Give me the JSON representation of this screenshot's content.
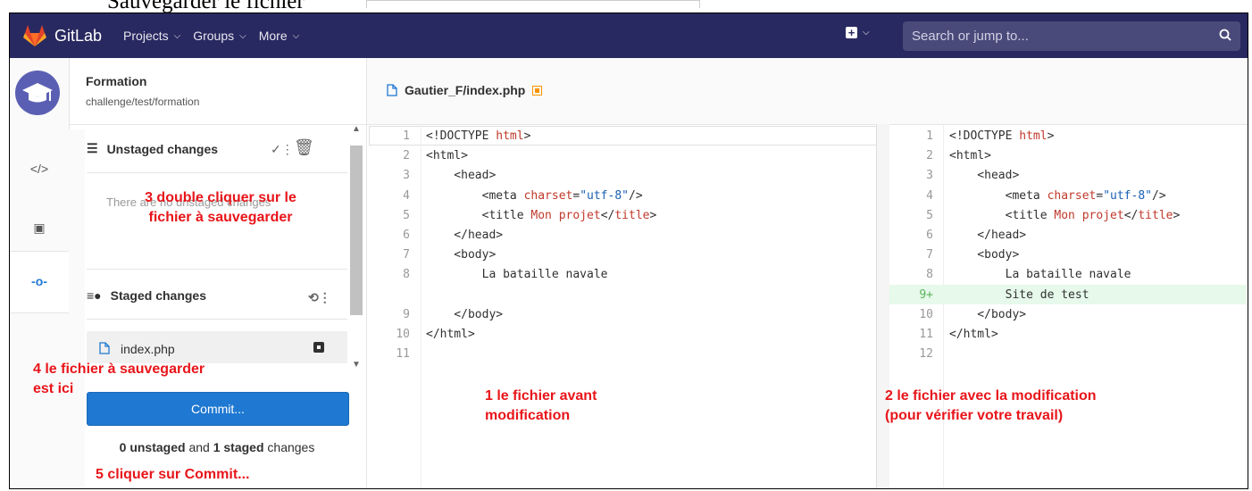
{
  "caption": "Sauvegarder le fichier",
  "navbar": {
    "brand": "GitLab",
    "links": [
      "Projects",
      "Groups",
      "More"
    ],
    "search_placeholder": "Search or jump to...",
    "colors": {
      "bg": "#292961",
      "search_bg": "#4a4a7a"
    }
  },
  "project": {
    "name": "Formation",
    "path": "challenge/test/formation"
  },
  "panel": {
    "unstaged_title": "Unstaged changes",
    "unstaged_empty": "There are no unstaged changes",
    "staged_title": "Staged changes",
    "staged_files": [
      "index.php"
    ],
    "commit_label": "Commit...",
    "summary": {
      "unstaged_count": "0 unstaged",
      "and": " and ",
      "staged_count": "1 staged",
      "suffix": " changes"
    }
  },
  "editor": {
    "file_path": "Gautier_F/index.php",
    "left_lines": [
      {
        "n": "1",
        "code": "<!DOCTYPE html>"
      },
      {
        "n": "2",
        "code": "<html>"
      },
      {
        "n": "3",
        "code": "    <head>"
      },
      {
        "n": "4",
        "code": "        <meta charset=\"utf-8\"/>"
      },
      {
        "n": "5",
        "code": "        <title Mon projet</title>"
      },
      {
        "n": "6",
        "code": "    </head>"
      },
      {
        "n": "7",
        "code": "    <body>"
      },
      {
        "n": "8",
        "code": "        La bataille navale"
      },
      {
        "n": "",
        "code": ""
      },
      {
        "n": "9",
        "code": "    </body>"
      },
      {
        "n": "10",
        "code": "</html>"
      },
      {
        "n": "11",
        "code": ""
      }
    ],
    "right_lines": [
      {
        "n": "1",
        "code": "<!DOCTYPE html>"
      },
      {
        "n": "2",
        "code": "<html>"
      },
      {
        "n": "3",
        "code": "    <head>"
      },
      {
        "n": "4",
        "code": "        <meta charset=\"utf-8\"/>"
      },
      {
        "n": "5",
        "code": "        <title Mon projet</title>"
      },
      {
        "n": "6",
        "code": "    </head>"
      },
      {
        "n": "7",
        "code": "    <body>"
      },
      {
        "n": "8",
        "code": "        La bataille navale"
      },
      {
        "n": "9+",
        "code": "        Site de test"
      },
      {
        "n": "10",
        "code": "    </body>"
      },
      {
        "n": "11",
        "code": "</html>"
      },
      {
        "n": "12",
        "code": ""
      }
    ]
  },
  "annotations": {
    "a1": [
      "1 le fichier avant",
      "modification"
    ],
    "a2": [
      "2 le fichier avec la modification",
      "(pour vérifier votre travail)"
    ],
    "a3": [
      "3 double cliquer sur le",
      "fichier à sauvegarder"
    ],
    "a4": [
      "4 le fichier à sauvegarder",
      "est ici"
    ],
    "a5": "5 cliquer sur Commit..."
  }
}
